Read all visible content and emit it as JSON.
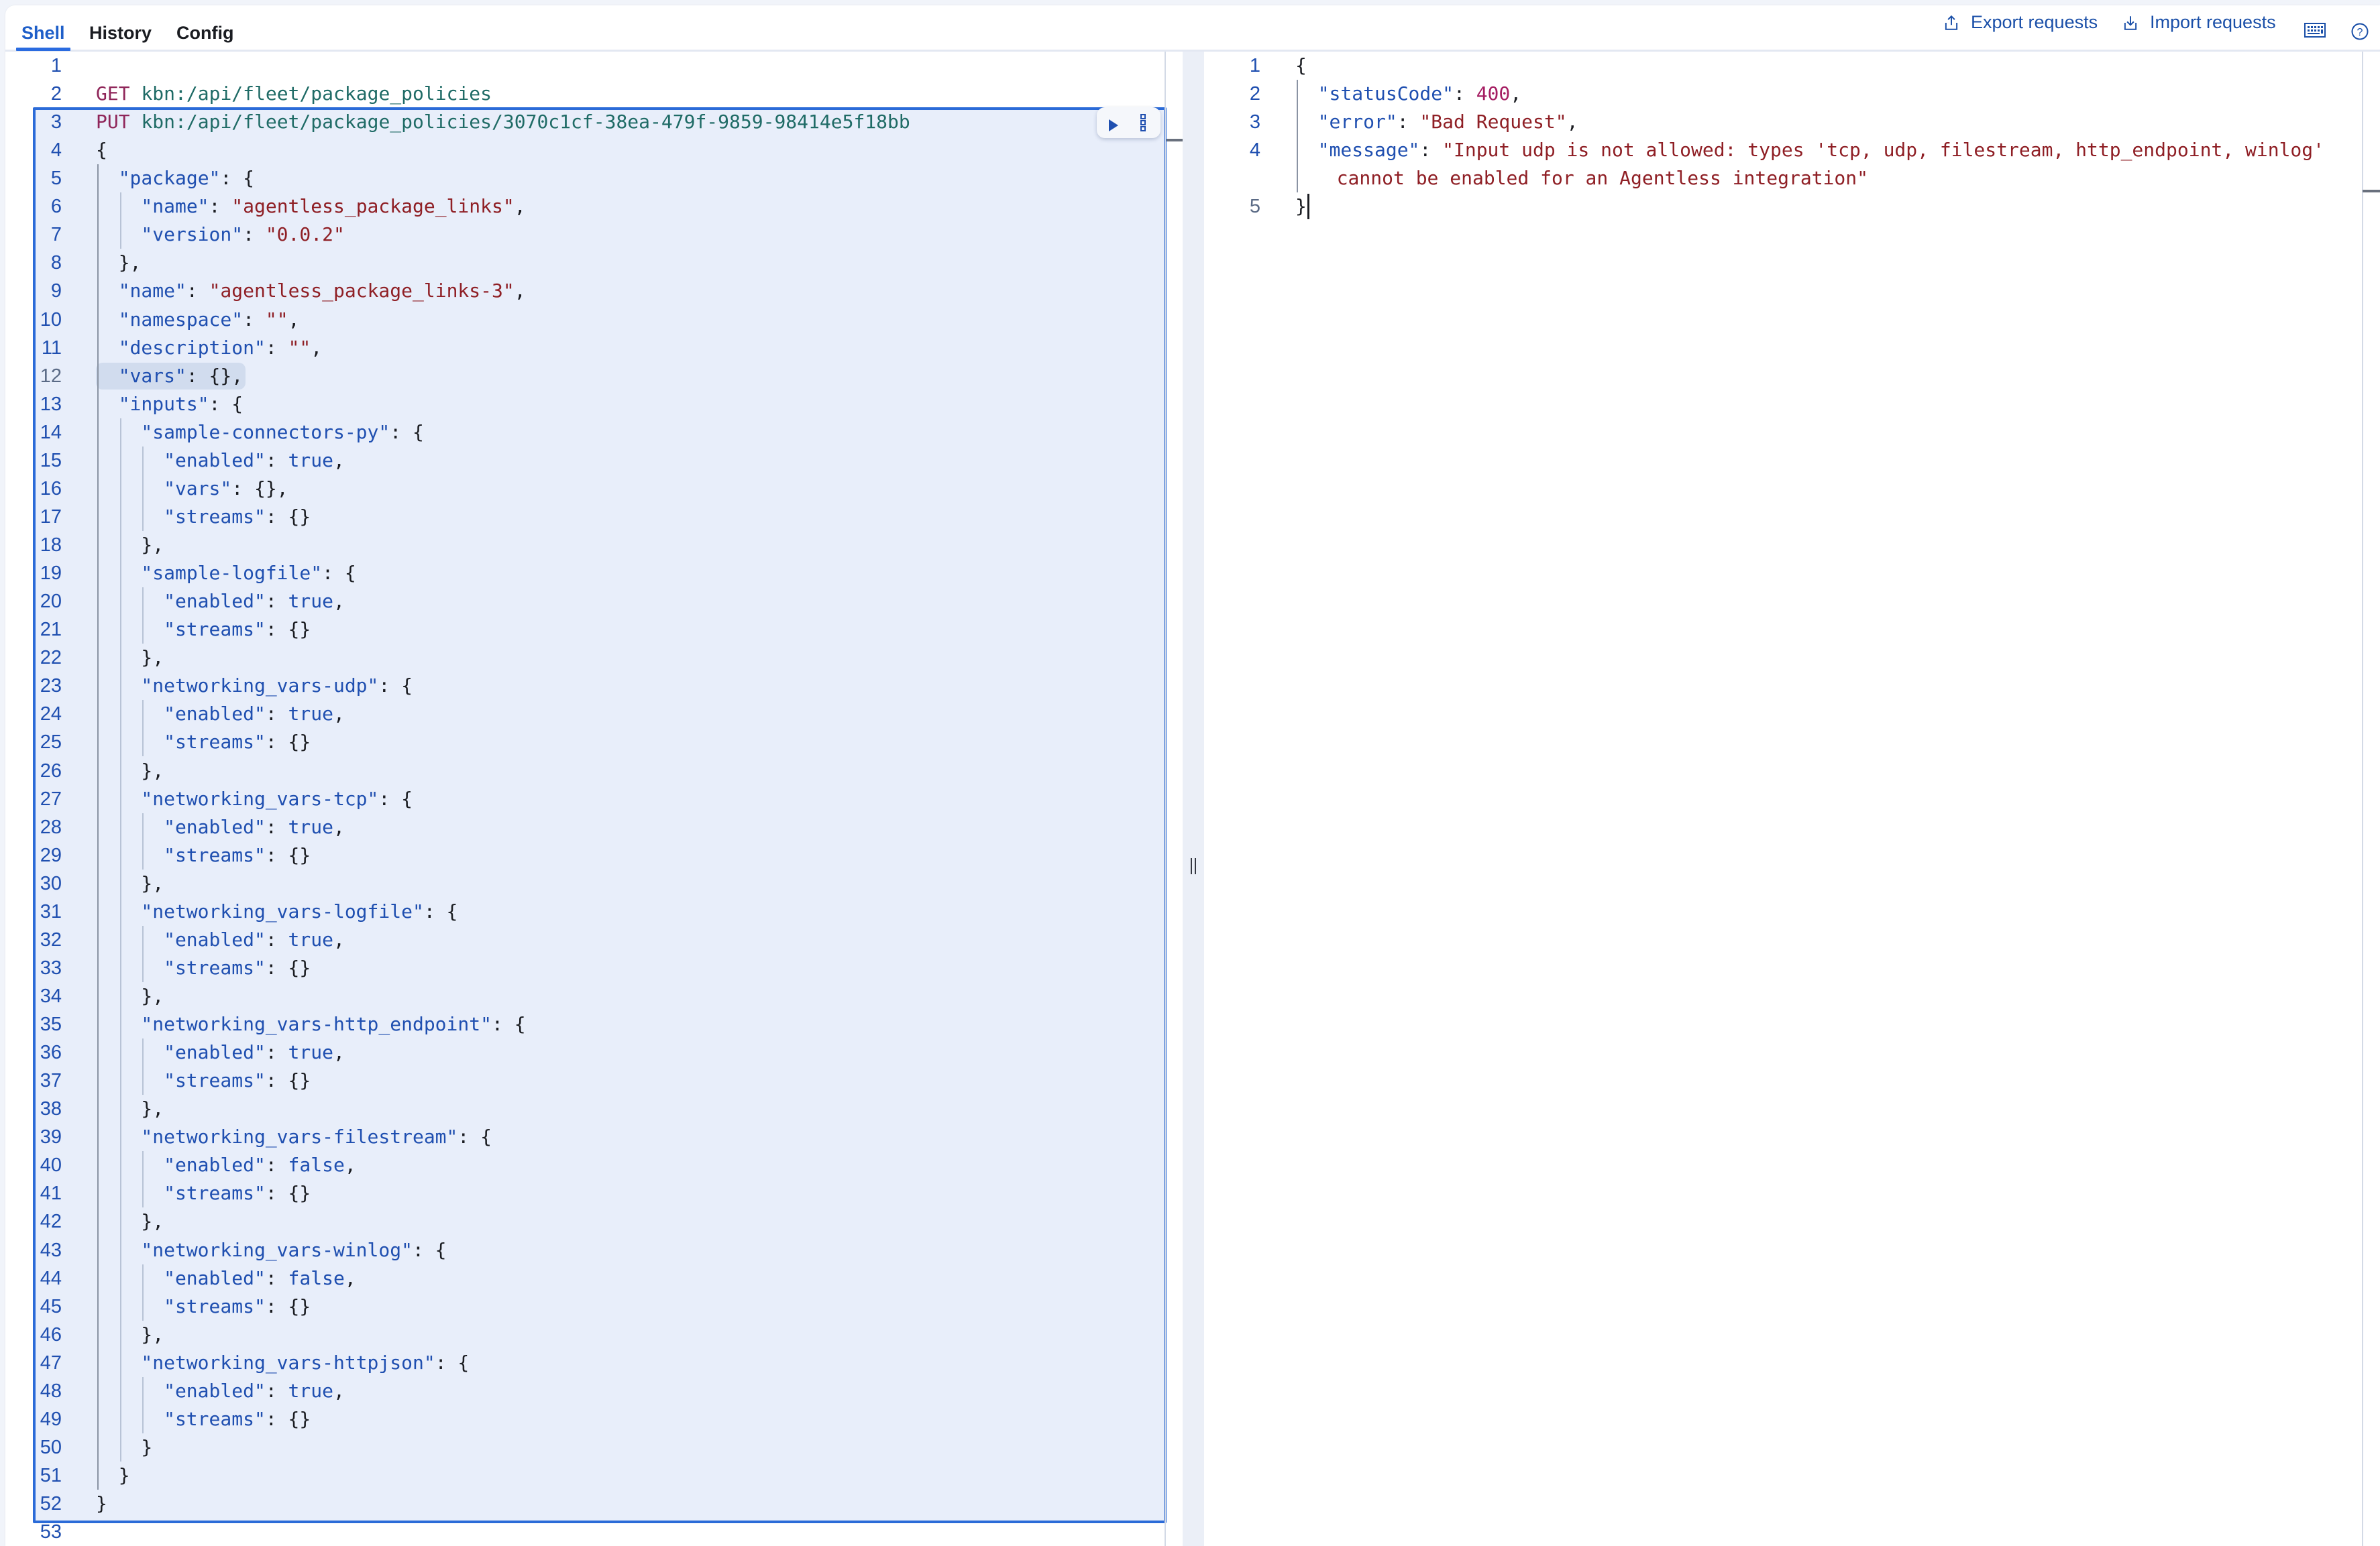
{
  "tabs": [
    {
      "label": "Shell",
      "active": true
    },
    {
      "label": "History",
      "active": false
    },
    {
      "label": "Config",
      "active": false
    }
  ],
  "actions": {
    "export_label": "Export requests",
    "import_label": "Import requests",
    "export_icon": "export-icon",
    "import_icon": "import-icon",
    "keyboard_icon": "keyboard-shortcuts-icon",
    "help_icon": "help-icon"
  },
  "colors": {
    "accent": "#2b6bd8",
    "method": "#8f2559",
    "url": "#1f6b66",
    "key": "#1f4fb0",
    "string": "#8f1f25",
    "number": "#a51d62",
    "selection_bg": "#e8eefa"
  },
  "request_editor": {
    "active_line": 12,
    "selected_request_lines": [
      3,
      52
    ],
    "lines": [
      {
        "n": 1,
        "indent": 0,
        "tokens": []
      },
      {
        "n": 2,
        "indent": 0,
        "tokens": [
          [
            "method",
            "GET"
          ],
          [
            "punct",
            " "
          ],
          [
            "url",
            "kbn:/api/fleet/package_policies"
          ]
        ]
      },
      {
        "n": 3,
        "indent": 0,
        "tokens": [
          [
            "method",
            "PUT"
          ],
          [
            "punct",
            " "
          ],
          [
            "url",
            "kbn:/api/fleet/package_policies/3070c1cf-38ea-479f-9859-98414e5f18bb"
          ]
        ]
      },
      {
        "n": 4,
        "indent": 0,
        "tokens": [
          [
            "punct",
            "{"
          ]
        ]
      },
      {
        "n": 5,
        "indent": 1,
        "tokens": [
          [
            "key",
            "\"package\""
          ],
          [
            "punct",
            ": {"
          ]
        ]
      },
      {
        "n": 6,
        "indent": 2,
        "tokens": [
          [
            "key",
            "\"name\""
          ],
          [
            "punct",
            ": "
          ],
          [
            "str",
            "\"agentless_package_links\""
          ],
          [
            "punct",
            ","
          ]
        ]
      },
      {
        "n": 7,
        "indent": 2,
        "tokens": [
          [
            "key",
            "\"version\""
          ],
          [
            "punct",
            ": "
          ],
          [
            "str",
            "\"0.0.2\""
          ]
        ]
      },
      {
        "n": 8,
        "indent": 1,
        "tokens": [
          [
            "punct",
            "},"
          ]
        ]
      },
      {
        "n": 9,
        "indent": 1,
        "tokens": [
          [
            "key",
            "\"name\""
          ],
          [
            "punct",
            ": "
          ],
          [
            "str",
            "\"agentless_package_links-3\""
          ],
          [
            "punct",
            ","
          ]
        ]
      },
      {
        "n": 10,
        "indent": 1,
        "tokens": [
          [
            "key",
            "\"namespace\""
          ],
          [
            "punct",
            ": "
          ],
          [
            "str",
            "\"\""
          ],
          [
            "punct",
            ","
          ]
        ]
      },
      {
        "n": 11,
        "indent": 1,
        "tokens": [
          [
            "key",
            "\"description\""
          ],
          [
            "punct",
            ": "
          ],
          [
            "str",
            "\"\""
          ],
          [
            "punct",
            ","
          ]
        ]
      },
      {
        "n": 12,
        "indent": 1,
        "tokens": [
          [
            "key",
            "\"vars\""
          ],
          [
            "punct",
            ": {},"
          ]
        ]
      },
      {
        "n": 13,
        "indent": 1,
        "tokens": [
          [
            "key",
            "\"inputs\""
          ],
          [
            "punct",
            ": {"
          ]
        ]
      },
      {
        "n": 14,
        "indent": 2,
        "tokens": [
          [
            "key",
            "\"sample-connectors-py\""
          ],
          [
            "punct",
            ": {"
          ]
        ]
      },
      {
        "n": 15,
        "indent": 3,
        "tokens": [
          [
            "key",
            "\"enabled\""
          ],
          [
            "punct",
            ": "
          ],
          [
            "bool",
            "true"
          ],
          [
            "punct",
            ","
          ]
        ]
      },
      {
        "n": 16,
        "indent": 3,
        "tokens": [
          [
            "key",
            "\"vars\""
          ],
          [
            "punct",
            ": {},"
          ]
        ]
      },
      {
        "n": 17,
        "indent": 3,
        "tokens": [
          [
            "key",
            "\"streams\""
          ],
          [
            "punct",
            ": {}"
          ]
        ]
      },
      {
        "n": 18,
        "indent": 2,
        "tokens": [
          [
            "punct",
            "},"
          ]
        ]
      },
      {
        "n": 19,
        "indent": 2,
        "tokens": [
          [
            "key",
            "\"sample-logfile\""
          ],
          [
            "punct",
            ": {"
          ]
        ]
      },
      {
        "n": 20,
        "indent": 3,
        "tokens": [
          [
            "key",
            "\"enabled\""
          ],
          [
            "punct",
            ": "
          ],
          [
            "bool",
            "true"
          ],
          [
            "punct",
            ","
          ]
        ]
      },
      {
        "n": 21,
        "indent": 3,
        "tokens": [
          [
            "key",
            "\"streams\""
          ],
          [
            "punct",
            ": {}"
          ]
        ]
      },
      {
        "n": 22,
        "indent": 2,
        "tokens": [
          [
            "punct",
            "},"
          ]
        ]
      },
      {
        "n": 23,
        "indent": 2,
        "tokens": [
          [
            "key",
            "\"networking_vars-udp\""
          ],
          [
            "punct",
            ": {"
          ]
        ]
      },
      {
        "n": 24,
        "indent": 3,
        "tokens": [
          [
            "key",
            "\"enabled\""
          ],
          [
            "punct",
            ": "
          ],
          [
            "bool",
            "true"
          ],
          [
            "punct",
            ","
          ]
        ]
      },
      {
        "n": 25,
        "indent": 3,
        "tokens": [
          [
            "key",
            "\"streams\""
          ],
          [
            "punct",
            ": {}"
          ]
        ]
      },
      {
        "n": 26,
        "indent": 2,
        "tokens": [
          [
            "punct",
            "},"
          ]
        ]
      },
      {
        "n": 27,
        "indent": 2,
        "tokens": [
          [
            "key",
            "\"networking_vars-tcp\""
          ],
          [
            "punct",
            ": {"
          ]
        ]
      },
      {
        "n": 28,
        "indent": 3,
        "tokens": [
          [
            "key",
            "\"enabled\""
          ],
          [
            "punct",
            ": "
          ],
          [
            "bool",
            "true"
          ],
          [
            "punct",
            ","
          ]
        ]
      },
      {
        "n": 29,
        "indent": 3,
        "tokens": [
          [
            "key",
            "\"streams\""
          ],
          [
            "punct",
            ": {}"
          ]
        ]
      },
      {
        "n": 30,
        "indent": 2,
        "tokens": [
          [
            "punct",
            "},"
          ]
        ]
      },
      {
        "n": 31,
        "indent": 2,
        "tokens": [
          [
            "key",
            "\"networking_vars-logfile\""
          ],
          [
            "punct",
            ": {"
          ]
        ]
      },
      {
        "n": 32,
        "indent": 3,
        "tokens": [
          [
            "key",
            "\"enabled\""
          ],
          [
            "punct",
            ": "
          ],
          [
            "bool",
            "true"
          ],
          [
            "punct",
            ","
          ]
        ]
      },
      {
        "n": 33,
        "indent": 3,
        "tokens": [
          [
            "key",
            "\"streams\""
          ],
          [
            "punct",
            ": {}"
          ]
        ]
      },
      {
        "n": 34,
        "indent": 2,
        "tokens": [
          [
            "punct",
            "},"
          ]
        ]
      },
      {
        "n": 35,
        "indent": 2,
        "tokens": [
          [
            "key",
            "\"networking_vars-http_endpoint\""
          ],
          [
            "punct",
            ": {"
          ]
        ]
      },
      {
        "n": 36,
        "indent": 3,
        "tokens": [
          [
            "key",
            "\"enabled\""
          ],
          [
            "punct",
            ": "
          ],
          [
            "bool",
            "true"
          ],
          [
            "punct",
            ","
          ]
        ]
      },
      {
        "n": 37,
        "indent": 3,
        "tokens": [
          [
            "key",
            "\"streams\""
          ],
          [
            "punct",
            ": {}"
          ]
        ]
      },
      {
        "n": 38,
        "indent": 2,
        "tokens": [
          [
            "punct",
            "},"
          ]
        ]
      },
      {
        "n": 39,
        "indent": 2,
        "tokens": [
          [
            "key",
            "\"networking_vars-filestream\""
          ],
          [
            "punct",
            ": {"
          ]
        ]
      },
      {
        "n": 40,
        "indent": 3,
        "tokens": [
          [
            "key",
            "\"enabled\""
          ],
          [
            "punct",
            ": "
          ],
          [
            "bool",
            "false"
          ],
          [
            "punct",
            ","
          ]
        ]
      },
      {
        "n": 41,
        "indent": 3,
        "tokens": [
          [
            "key",
            "\"streams\""
          ],
          [
            "punct",
            ": {}"
          ]
        ]
      },
      {
        "n": 42,
        "indent": 2,
        "tokens": [
          [
            "punct",
            "},"
          ]
        ]
      },
      {
        "n": 43,
        "indent": 2,
        "tokens": [
          [
            "key",
            "\"networking_vars-winlog\""
          ],
          [
            "punct",
            ": {"
          ]
        ]
      },
      {
        "n": 44,
        "indent": 3,
        "tokens": [
          [
            "key",
            "\"enabled\""
          ],
          [
            "punct",
            ": "
          ],
          [
            "bool",
            "false"
          ],
          [
            "punct",
            ","
          ]
        ]
      },
      {
        "n": 45,
        "indent": 3,
        "tokens": [
          [
            "key",
            "\"streams\""
          ],
          [
            "punct",
            ": {}"
          ]
        ]
      },
      {
        "n": 46,
        "indent": 2,
        "tokens": [
          [
            "punct",
            "},"
          ]
        ]
      },
      {
        "n": 47,
        "indent": 2,
        "tokens": [
          [
            "key",
            "\"networking_vars-httpjson\""
          ],
          [
            "punct",
            ": {"
          ]
        ]
      },
      {
        "n": 48,
        "indent": 3,
        "tokens": [
          [
            "key",
            "\"enabled\""
          ],
          [
            "punct",
            ": "
          ],
          [
            "bool",
            "true"
          ],
          [
            "punct",
            ","
          ]
        ]
      },
      {
        "n": 49,
        "indent": 3,
        "tokens": [
          [
            "key",
            "\"streams\""
          ],
          [
            "punct",
            ": {}"
          ]
        ]
      },
      {
        "n": 50,
        "indent": 2,
        "tokens": [
          [
            "punct",
            "}"
          ]
        ]
      },
      {
        "n": 51,
        "indent": 1,
        "tokens": [
          [
            "punct",
            "}"
          ]
        ]
      },
      {
        "n": 52,
        "indent": 0,
        "tokens": [
          [
            "punct",
            "}"
          ]
        ]
      },
      {
        "n": 53,
        "indent": 0,
        "tokens": []
      }
    ],
    "run_button_icon": "play-icon",
    "more_actions_icon": "more-vertical-icon"
  },
  "response_output": {
    "active_line": 5,
    "lines": [
      {
        "n": "1",
        "indent": 0,
        "tokens": [
          [
            "punct",
            "{"
          ]
        ]
      },
      {
        "n": "2",
        "indent": 1,
        "tokens": [
          [
            "key",
            "\"statusCode\""
          ],
          [
            "punct",
            ": "
          ],
          [
            "num",
            "400"
          ],
          [
            "punct",
            ","
          ]
        ]
      },
      {
        "n": "3",
        "indent": 1,
        "tokens": [
          [
            "key",
            "\"error\""
          ],
          [
            "punct",
            ": "
          ],
          [
            "str",
            "\"Bad Request\""
          ],
          [
            "punct",
            ","
          ]
        ]
      },
      {
        "n": "4",
        "indent": 1,
        "tokens": [
          [
            "key",
            "\"message\""
          ],
          [
            "punct",
            ": "
          ],
          [
            "str",
            "\"Input udp is not allowed: types 'tcp, udp, filestream, http_endpoint, winlog'"
          ]
        ]
      },
      {
        "n": "",
        "indent": 2,
        "wrap": true,
        "tokens": [
          [
            "str",
            "cannot be enabled for an Agentless integration\""
          ]
        ]
      },
      {
        "n": "5",
        "indent": 0,
        "tokens": [
          [
            "punct",
            "}"
          ]
        ]
      }
    ]
  }
}
